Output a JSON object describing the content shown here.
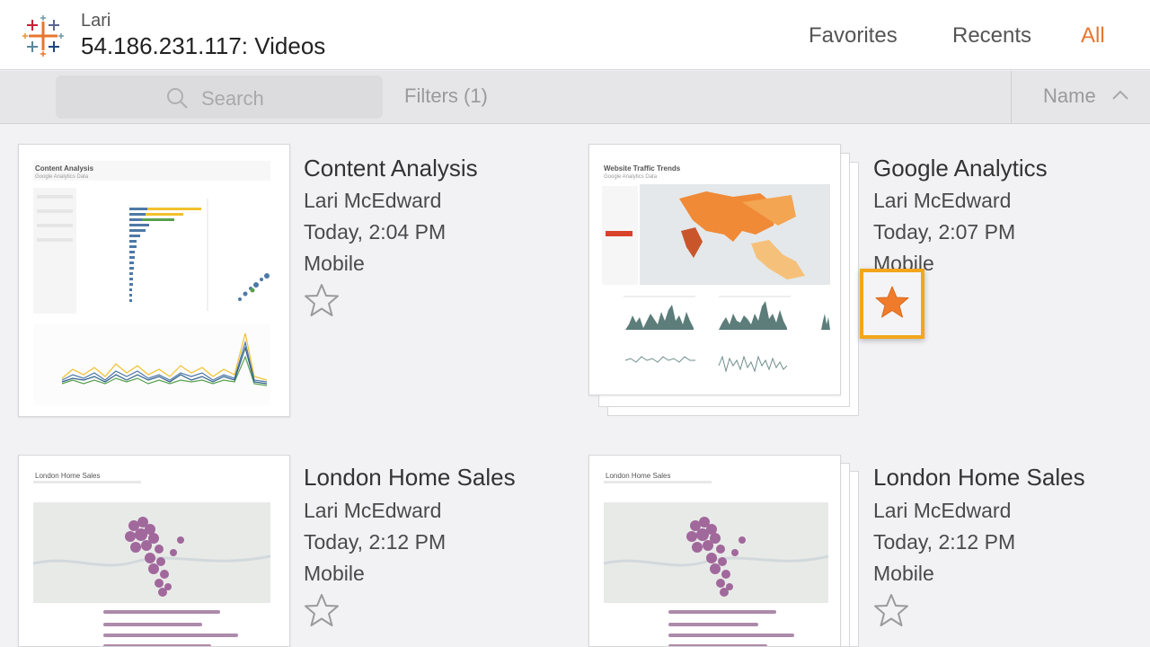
{
  "header": {
    "site_name": "Lari",
    "title": "54.186.231.117: Videos",
    "tabs": [
      {
        "label": "Favorites",
        "active": false
      },
      {
        "label": "Recents",
        "active": false
      },
      {
        "label": "All",
        "active": true
      }
    ],
    "accent_color": "#e8762d"
  },
  "toolbar": {
    "search_placeholder": "Search",
    "filters_label": "Filters (1)",
    "sort_label": "Name",
    "sort_direction_icon": "chevron-up-icon"
  },
  "workbooks": [
    {
      "title": "Content Analysis",
      "owner": "Lari McEdward",
      "modified": "Today, 2:04 PM",
      "project": "Mobile",
      "favorite": false,
      "thumb_title": "Content Analysis",
      "thumb_subtitle": "Google Analytics Data"
    },
    {
      "title": "Google Analytics",
      "owner": "Lari McEdward",
      "modified": "Today, 2:07 PM",
      "project": "Mobile",
      "favorite": true,
      "thumb_title": "Website Traffic Trends",
      "thumb_subtitle": "Google Analytics Data"
    },
    {
      "title": "London Home Sales",
      "owner": "Lari McEdward",
      "modified": "Today, 2:12 PM",
      "project": "Mobile",
      "favorite": false,
      "thumb_title": "London Home Sales",
      "thumb_subtitle": ""
    },
    {
      "title": "London Home Sales",
      "owner": "Lari McEdward",
      "modified": "Today, 2:12 PM",
      "project": "Mobile",
      "favorite": false,
      "thumb_title": "London Home Sales",
      "thumb_subtitle": ""
    }
  ],
  "colors": {
    "favorite_star": "#f07c2b",
    "highlight_border": "#f3a51b",
    "map_region": "#f08a36",
    "dots": "#9a5a94"
  }
}
